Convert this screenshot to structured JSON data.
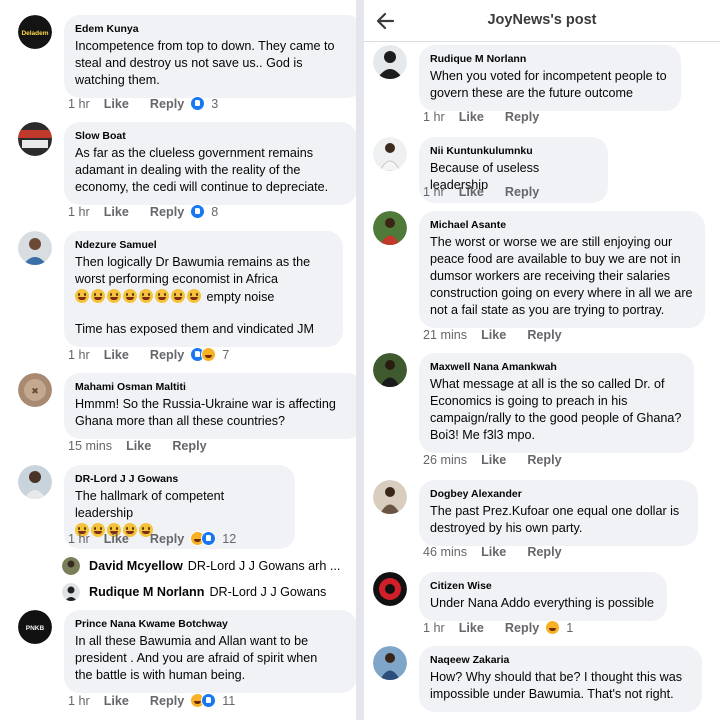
{
  "left_comments": [
    {
      "name": "Edem Kunya",
      "lines": [
        "Incompetence from top to down. They came to",
        "steal and destroy us not save us.. God is",
        "watching them."
      ],
      "time": "1 hr",
      "like": "Like",
      "reply": "Reply",
      "reaction_count": "3",
      "avatar_logo_text": "Deladem",
      "reactions": [
        "like"
      ]
    },
    {
      "name": "Slow Boat",
      "lines": [
        "As far as the clueless government remains",
        "adamant in dealing with the reality of the",
        "economy, the cedi will continue to depreciate."
      ],
      "time": "1 hr",
      "like": "Like",
      "reply": "Reply",
      "reaction_count": "8",
      "reactions": [
        "like"
      ]
    },
    {
      "name": "Ndezure Samuel",
      "lines": [
        "Then logically Dr Bawumia remains as the",
        "worst performing economist in Africa"
      ],
      "emoji_line_text": "empty noise",
      "extra_line": "Time has exposed them and vindicated JM",
      "time": "1 hr",
      "like": "Like",
      "reply": "Reply",
      "reaction_count": "7",
      "reactions": [
        "like",
        "haha"
      ]
    },
    {
      "name": "Mahami Osman Maltiti",
      "lines": [
        "Hmmm! So the Russia-Ukraine war is affecting",
        "Ghana more than all these countries?"
      ],
      "time": "15 mins",
      "like": "Like",
      "reply": "Reply"
    },
    {
      "name": "DR-Lord J J Gowans",
      "lines": [
        "The hallmark of competent leadership"
      ],
      "time": "1 hr",
      "like": "Like",
      "reply": "Reply",
      "reaction_count": "12",
      "reactions": [
        "haha",
        "like"
      ]
    },
    {
      "name": "Prince Nana Kwame Botchway",
      "lines": [
        "In all these Bawumia and Allan want to be",
        "president . And you are afraid of spirit when",
        "the battle is with human being."
      ],
      "time": "1 hr",
      "like": "Like",
      "reply": "Reply",
      "reaction_count": "11",
      "avatar_logo_text": "PNKB",
      "reactions": [
        "haha",
        "like"
      ]
    }
  ],
  "reply_previews": [
    {
      "name": "David Mcyellow",
      "text": "DR-Lord J J Gowans arh ..."
    },
    {
      "name": "Rudique M Norlann",
      "text": "DR-Lord J J Gowans"
    }
  ],
  "right_header": {
    "title": "JoyNews's post"
  },
  "right_comments": [
    {
      "name": "Rudique M Norlann",
      "lines": [
        "When you voted for incompetent people to",
        "govern these are the future outcome"
      ],
      "time": "1 hr",
      "like": "Like",
      "reply": "Reply"
    },
    {
      "name": "Nii Kuntunkulumnku",
      "lines": [
        "Because of useless leadership"
      ],
      "time": "1 hr",
      "like": "Like",
      "reply": "Reply"
    },
    {
      "name": "Michael Asante",
      "lines": [
        "The worst or worse we are still enjoying our",
        "peace food are available to buy we are not in",
        "dumsor workers are receiving their salaries",
        "construction going on every where in all we are",
        "not a fail state as you are trying to portray."
      ],
      "time": "21 mins",
      "like": "Like",
      "reply": "Reply"
    },
    {
      "name": "Maxwell Nana Amankwah",
      "lines": [
        "What message at all is the so called Dr. of",
        "Economics is going to preach in his",
        "campaign/rally to the good people of Ghana?",
        "Boi3! Me f3l3 mpo."
      ],
      "time": "26 mins",
      "like": "Like",
      "reply": "Reply"
    },
    {
      "name": "Dogbey Alexander",
      "lines": [
        "The past Prez.Kufoar one equal one dollar is",
        "destroyed by his own party."
      ],
      "time": "46 mins",
      "like": "Like",
      "reply": "Reply"
    },
    {
      "name": "Citizen Wise",
      "lines": [
        "Under Nana Addo everything is possible"
      ],
      "time": "1 hr",
      "like": "Like",
      "reply": "Reply",
      "reaction_count": "1",
      "reactions": [
        "haha"
      ]
    },
    {
      "name": "Naqeew Zakaria",
      "lines": [
        "How? Why should that be? I thought this was",
        "impossible under Bawumia. That's not right."
      ]
    }
  ],
  "colors": {
    "bubble": "#f0f2f5",
    "meta_text": "#65676b",
    "like_blue": "#1877f2",
    "haha_yellow": "#f7b125",
    "divider": "#e4e6eb"
  }
}
